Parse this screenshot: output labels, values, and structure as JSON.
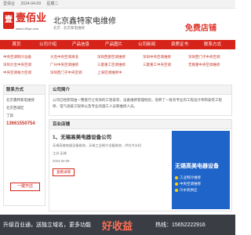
{
  "topbar": {
    "site": "壹佰业",
    "date": "2024-04-09",
    "weekday": "星期二"
  },
  "logo": {
    "mark": "壹",
    "name": "壹佰业",
    "url": "www.100ye.com"
  },
  "company": {
    "title": "北京鑫特家电维修",
    "sub": "北京 · 北京家电维修"
  },
  "free_shop": "免费店铺",
  "nav": [
    "首页",
    "公司介绍",
    "产品信息",
    "产品图片",
    "公司新闻",
    "资质证书",
    "联系方式"
  ],
  "categories": [
    "中央空调制冷设备",
    "大连中央空调清洗",
    "深圳西部空调维修",
    "深圳中央空调维修",
    "深圳西门子中央空调",
    "深圳力宝中央空调",
    "广州中央空调维修",
    "三菱重工空调维修",
    "三菱重工中央空调",
    "无锡重中央空调维修",
    "中央空调格力空调",
    "深圳西门子中央空调",
    "上海空调维修中"
  ],
  "sidebar": {
    "head": "联系方式",
    "company": "北京鑫特家电维修",
    "location": "北京西城区",
    "contact": "丁茹",
    "phone": "13661550754",
    "button": "一键开店"
  },
  "about": {
    "head": "公司简介",
    "text": "公司已经获得由一整套行之有效的工程安装、设备维修管理经验，培养了一批有专业的工程设计师和安装工程师、电气高级工程师以及专业的施工人员和维修人员。"
  },
  "shop": {
    "head": "百业店铺",
    "item_title": "1、无锡高美电器设备公司",
    "item_desc": "无锡高美电器设备维修，无锡工业制冷设备维修，供应冷水机",
    "item_loc": "江苏 无锡",
    "item_date": "2024-04-09",
    "item_btn": "查看详情",
    "promo_title": "无锡高美电器设备",
    "promo_points": [
      "工业制冷维修",
      "中央空调维修",
      "冷水机供应"
    ]
  },
  "footer": {
    "text": "升级百业通，送独立域名，更多功能",
    "mid": "好收益",
    "phone": "热线：15652222916"
  }
}
